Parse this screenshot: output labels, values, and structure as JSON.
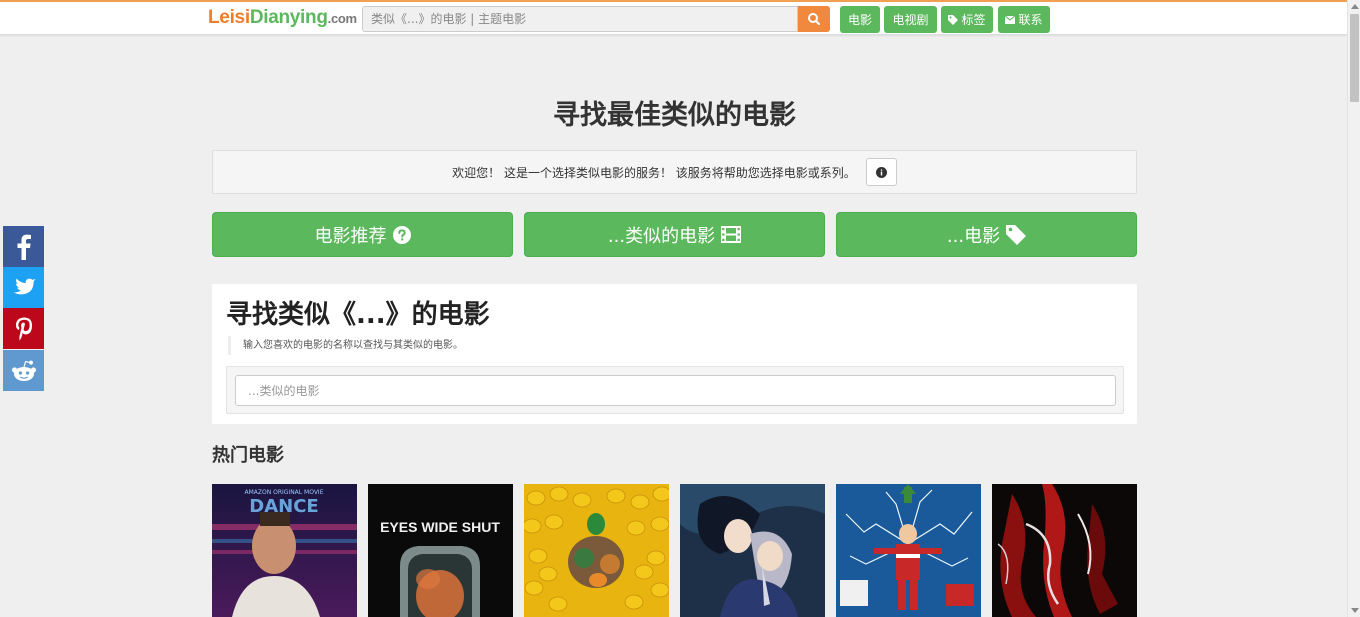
{
  "header": {
    "logo": {
      "part1": "Leisi",
      "part2": "Dianying",
      "part3": ".com"
    },
    "search_placeholder": "类似《...》的电影 | 主题电影",
    "nav": [
      {
        "label": "电影",
        "icon": ""
      },
      {
        "label": "电视剧",
        "icon": ""
      },
      {
        "label": "标签",
        "icon": "tag-icon"
      },
      {
        "label": "联系",
        "icon": "envelope-icon"
      }
    ]
  },
  "hero": {
    "title": "寻找最佳类似的电影",
    "welcome_text": "欢迎您！ 这是一个选择类似电影的服务！ 该服务将帮助您选择电影或系列。",
    "info_icon": "info-circle-icon"
  },
  "big_buttons": [
    {
      "label": "电影推荐",
      "icon": "question-circle-icon"
    },
    {
      "label": "...类似的电影",
      "icon": "film-icon"
    },
    {
      "label": "...电影",
      "icon": "tag-icon"
    }
  ],
  "finder": {
    "title": "寻找类似《...》的电影",
    "note": "输入您喜欢的电影的名称以查找与其类似的电影。",
    "input_placeholder": "...类似的电影"
  },
  "popular": {
    "title": "热门电影",
    "posters": [
      {
        "name": "poster-roadhouse",
        "text": "DANCE",
        "text_top": "AMAZON ORIGINAL MOVIE"
      },
      {
        "name": "poster-eyes-wide-shut",
        "text": "EYES WIDE SHUT",
        "text_top": ""
      },
      {
        "name": "poster-migration",
        "text": "",
        "text_top": ""
      },
      {
        "name": "poster-howls-moving-castle",
        "text": "",
        "text_top": ""
      },
      {
        "name": "poster-christmas-vacation",
        "text": "",
        "text_top": ""
      },
      {
        "name": "poster-abstract-red",
        "text": "",
        "text_top": ""
      }
    ]
  },
  "social": [
    {
      "network": "facebook",
      "icon": "facebook-icon",
      "color": "#3b5998"
    },
    {
      "network": "twitter",
      "icon": "twitter-icon",
      "color": "#1da1f2"
    },
    {
      "network": "pinterest",
      "icon": "pinterest-icon",
      "color": "#bd081c"
    },
    {
      "network": "reddit",
      "icon": "reddit-icon",
      "color": "#5f99cf"
    }
  ],
  "colors": {
    "accent_orange": "#f0883e",
    "accent_green": "#5cb85c",
    "background": "#efefef"
  }
}
